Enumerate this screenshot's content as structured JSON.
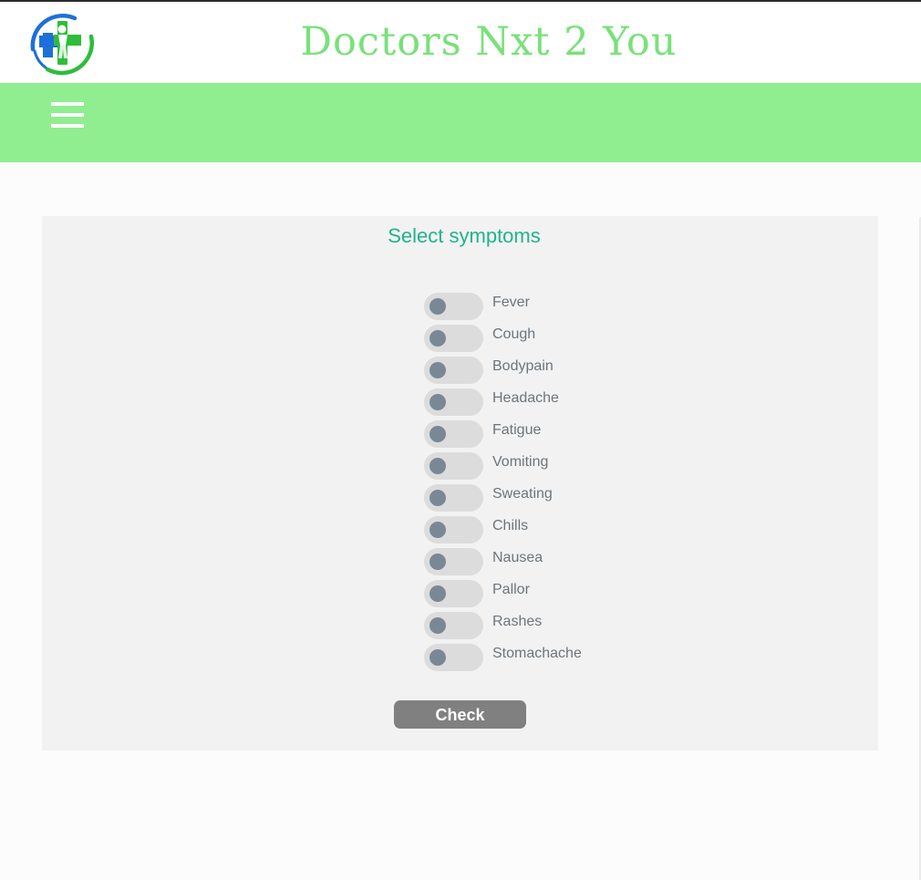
{
  "header": {
    "site_title": "Doctors Nxt 2 You",
    "logo_icon": "medical-cross-person-icon",
    "colors": {
      "title": "#79e17a",
      "logo_green": "#2ebd3b",
      "logo_blue": "#1e6fd9"
    }
  },
  "navbar": {
    "menu_icon": "hamburger-menu-icon",
    "background": "#90ee90"
  },
  "form": {
    "title": "Select symptoms",
    "symptoms": [
      {
        "label": "Fever",
        "checked": false
      },
      {
        "label": "Cough",
        "checked": false
      },
      {
        "label": "Bodypain",
        "checked": false
      },
      {
        "label": "Headache",
        "checked": false
      },
      {
        "label": "Fatigue",
        "checked": false
      },
      {
        "label": "Vomiting",
        "checked": false
      },
      {
        "label": "Sweating",
        "checked": false
      },
      {
        "label": "Chills",
        "checked": false
      },
      {
        "label": "Nausea",
        "checked": false
      },
      {
        "label": "Pallor",
        "checked": false
      },
      {
        "label": "Rashes",
        "checked": false
      },
      {
        "label": "Stomachache",
        "checked": false
      }
    ],
    "check_label": "Check",
    "colors": {
      "title": "#20b38c",
      "button": "#808080",
      "toggle_track": "#dcdcdc",
      "toggle_knob": "#7a8896"
    }
  }
}
